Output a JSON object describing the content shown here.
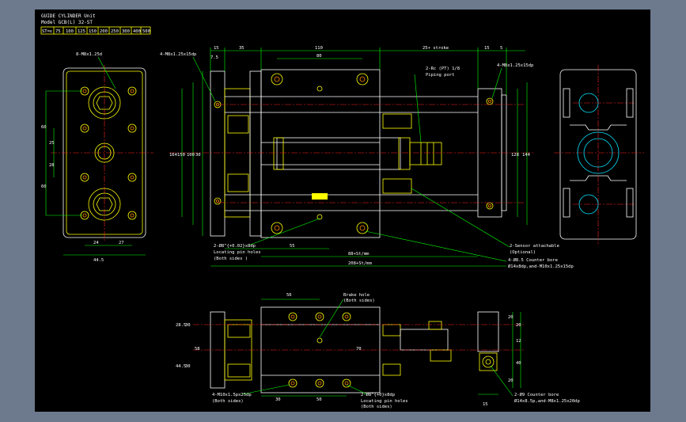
{
  "title": {
    "line1": "GUIDE CYLINDER Unit",
    "line2": "Model  GCB(L) 32-ST"
  },
  "stroke_table": {
    "header": "ST=ε",
    "values": [
      "75",
      "100",
      "125",
      "150",
      "200",
      "250",
      "300",
      "400",
      "500"
    ]
  },
  "dims_top": {
    "d15a": "15",
    "d35": "35",
    "d110": "110",
    "d80": "80",
    "d25st": "25+ stroke",
    "d15b": "15",
    "d5": "5",
    "d7_5": "7.5"
  },
  "dims_side": {
    "d164": "164",
    "d150": "150",
    "d100": "100",
    "d30": "30",
    "d128": "128",
    "d144": "144",
    "d60a": "60",
    "d25": "25",
    "d28": "28",
    "d60b": "60",
    "d24": "24",
    "d27": "27",
    "d44": "44.5"
  },
  "dims_bottom": {
    "d55": "55",
    "d88st": "88+St/mm",
    "d208st": "208+St/mm"
  },
  "notes_top": {
    "holes8": "8-M8x1.25d",
    "holes4l": "4-M8x1.25x15dp",
    "rc": "2-Rc (PT) 1/8",
    "rc_sub": "Piping port",
    "holes4r": "4-M8x1.25x15dp"
  },
  "notes_mid": {
    "pin1": "2-Ø8^{+0.02}x8dp",
    "pin1_sub": "Locating pin holes",
    "pin1_sub2": "(Both sides )",
    "sensor": "2-Sensor attachable",
    "sensor_sub": "(Optional)",
    "cbore": "4-Ø8.5 Counter bore",
    "cbore_sub": "Ø14x8dp,and-M10x1.25x15dp"
  },
  "dims_lower": {
    "d56": "56",
    "d58": "58",
    "d28_5": "28.5",
    "d30": "30",
    "d30b": "30",
    "d44_5": "44.5",
    "d30c": "30",
    "d50": "50",
    "d70": "70",
    "d20a": "20",
    "d20b": "20",
    "d20c": "20",
    "d12": "12",
    "d15": "15",
    "d40": "40"
  },
  "notes_lower": {
    "brake": "Brake hole",
    "brake_sub": "(Both sides)",
    "m10": "4-M10x1.5px25dp",
    "m10_sub": "(Both sides)",
    "pin2": "2-Ø8^{+0}x8dp",
    "pin2_sub": "Locating pin holes",
    "pin2_sub2": "(Both sides)",
    "cb2": "2-Ø9 Counter bore",
    "cb2_sub": "Ø14x8.5p,and-M8x1.25x20dp"
  }
}
